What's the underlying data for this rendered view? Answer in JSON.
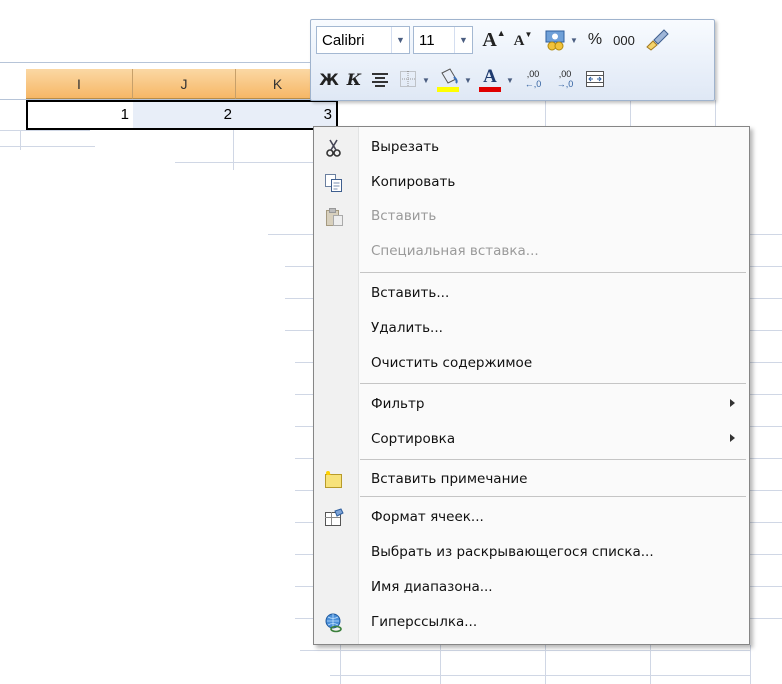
{
  "sheet": {
    "columns": [
      "I",
      "J",
      "K"
    ],
    "values": [
      "1",
      "2",
      "3"
    ]
  },
  "mini_toolbar": {
    "font_name": "Calibri",
    "font_size": "11",
    "grow_font": "A",
    "shrink_font": "A",
    "percent": "%",
    "thousands": "000",
    "bold": "Ж",
    "italic": "К",
    "font_color_letter": "A",
    "increase_decimal": ",00",
    "decrease_decimal": ",00"
  },
  "menu": {
    "items": [
      {
        "label": "Вырезать",
        "icon": "scissors-icon",
        "enabled": true
      },
      {
        "label": "Копировать",
        "icon": "copy-icon",
        "enabled": true
      },
      {
        "label": "Вставить",
        "icon": "paste-icon",
        "enabled": false
      },
      {
        "label": "Специальная вставка...",
        "icon": "",
        "enabled": false
      },
      {
        "label": "Вставить...",
        "icon": "",
        "enabled": true
      },
      {
        "label": "Удалить...",
        "icon": "",
        "enabled": true
      },
      {
        "label": "Очистить содержимое",
        "icon": "",
        "enabled": true
      },
      {
        "label": "Фильтр",
        "icon": "",
        "enabled": true,
        "submenu": true
      },
      {
        "label": "Сортировка",
        "icon": "",
        "enabled": true,
        "submenu": true
      },
      {
        "label": "Вставить примечание",
        "icon": "insert-comment-icon",
        "enabled": true
      },
      {
        "label": "Формат ячеек...",
        "icon": "format-cells-icon",
        "enabled": true
      },
      {
        "label": "Выбрать из раскрывающегося списка...",
        "icon": "",
        "enabled": true
      },
      {
        "label": "Имя диапазона...",
        "icon": "",
        "enabled": true
      },
      {
        "label": "Гиперссылка...",
        "icon": "hyperlink-icon",
        "enabled": true
      }
    ]
  },
  "colors": {
    "header_orange": "#f6b766",
    "highlight_yellow": "#ffff00",
    "font_red": "#e00000",
    "selection_tint": "#e8eef8"
  }
}
